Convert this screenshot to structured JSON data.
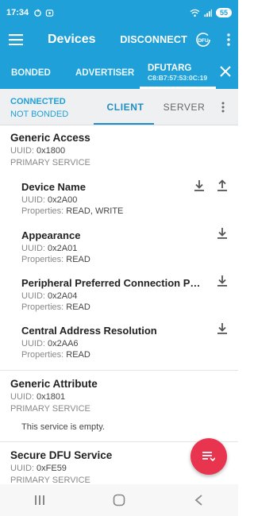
{
  "status_bar": {
    "time": "17:34",
    "battery": "55"
  },
  "app_bar": {
    "title": "Devices",
    "disconnect_label": "DISCONNECT",
    "dfu_label": "DFU"
  },
  "tabs": {
    "bonded": "BONDED",
    "advertiser": "ADVERTISER",
    "device_name": "DFUTARG",
    "device_address": "C8:B7:57:53:0C:19"
  },
  "connection": {
    "state": "CONNECTED",
    "bond": "NOT BONDED",
    "client_tab": "CLIENT",
    "server_tab": "SERVER"
  },
  "labels": {
    "uuid": "UUID:",
    "properties": "Properties:"
  },
  "services": [
    {
      "name": "Generic Access",
      "uuid": "0x1800",
      "type": "PRIMARY SERVICE",
      "characteristics": [
        {
          "name": "Device Name",
          "uuid": "0x2A00",
          "properties": "READ, WRITE"
        },
        {
          "name": "Appearance",
          "uuid": "0x2A01",
          "properties": "READ"
        },
        {
          "name": "Peripheral Preferred Connection Para...",
          "uuid": "0x2A04",
          "properties": "READ"
        },
        {
          "name": "Central Address Resolution",
          "uuid": "0x2AA6",
          "properties": "READ"
        }
      ]
    },
    {
      "name": "Generic Attribute",
      "uuid": "0x1801",
      "type": "PRIMARY SERVICE",
      "empty_message": "This service is empty."
    },
    {
      "name": "Secure DFU Service",
      "uuid": "0xFE59",
      "type": "PRIMARY SERVICE"
    }
  ],
  "icons": {
    "accent": "#1fa0d8",
    "fab_color": "#e8344f",
    "fab_icon": "log-icon",
    "download": "download-icon",
    "upload": "upload-icon"
  }
}
